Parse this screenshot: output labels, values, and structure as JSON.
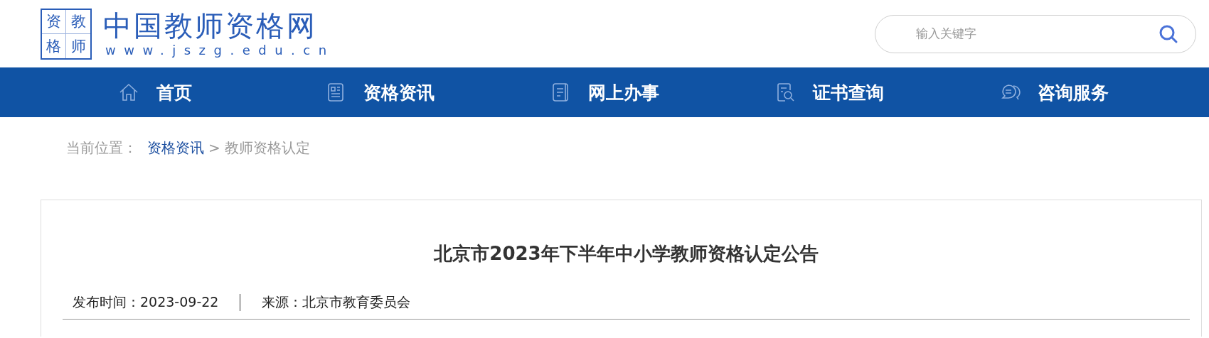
{
  "header": {
    "logo_cells": [
      "资",
      "教",
      "格",
      "师"
    ],
    "site_name": "中国教师资格网",
    "site_url": "www.jszg.edu.cn",
    "search": {
      "placeholder": "输入关键字"
    }
  },
  "nav": [
    {
      "kind": "home",
      "label": "首页"
    },
    {
      "kind": "news",
      "label": "资格资讯"
    },
    {
      "kind": "document",
      "label": "网上办事"
    },
    {
      "kind": "lookup",
      "label": "证书查询"
    },
    {
      "kind": "chat",
      "label": "咨询服务"
    }
  ],
  "breadcrumb": {
    "label": "当前位置：",
    "link": "资格资讯",
    "current": "> 教师资格认定"
  },
  "article": {
    "title": "北京市2023年下半年中小学教师资格认定公告",
    "published": "发布时间：2023-09-22",
    "source": "来源：北京市教育委员会"
  }
}
